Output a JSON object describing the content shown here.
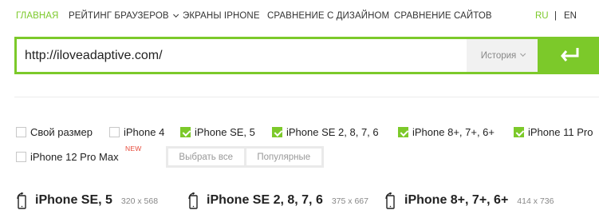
{
  "nav": {
    "items": [
      "ГЛАВНАЯ",
      "РЕЙТИНГ БРАУЗЕРОВ",
      "ЭКРАНЫ IPHONE",
      "СРАВНЕНИЕ С ДИЗАЙНОМ",
      "СРАВНЕНИЕ САЙТОВ"
    ],
    "lang_ru": "RU",
    "lang_sep": "|",
    "lang_en": "EN"
  },
  "urlbar": {
    "value": "http://iloveadaptive.com/",
    "history_label": "История"
  },
  "devices": [
    {
      "label": "Свой размер",
      "checked": false
    },
    {
      "label": "iPhone 4",
      "checked": false
    },
    {
      "label": "iPhone SE, 5",
      "checked": true
    },
    {
      "label": "iPhone SE 2, 8, 7, 6",
      "checked": true
    },
    {
      "label": "iPhone 8+, 7+, 6+",
      "checked": true
    },
    {
      "label": "iPhone 11 Pro",
      "checked": true
    },
    {
      "label": "iPhone 12 Pro Max",
      "checked": false
    }
  ],
  "new_badge": "NEW",
  "buttons": {
    "select_all": "Выбрать все",
    "popular": "Популярные"
  },
  "previews": [
    {
      "name": "iPhone SE, 5",
      "dims": "320 x 568"
    },
    {
      "name": "iPhone SE 2, 8, 7, 6",
      "dims": "375 x 667"
    },
    {
      "name": "iPhone 8+, 7+, 6+",
      "dims": "414 x 736"
    }
  ],
  "colors": {
    "accent": "#7cc92a",
    "badge": "#e74c3c"
  },
  "icons": {
    "enter": "enter-arrow-icon",
    "phone": "phone-rotate-icon"
  }
}
